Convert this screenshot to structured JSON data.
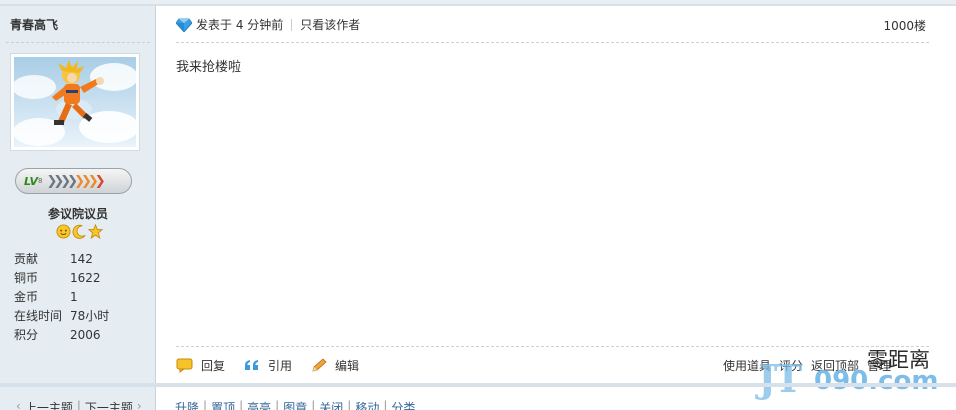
{
  "user": {
    "name": "青春高飞",
    "level_text": "LV",
    "level_sup": "8",
    "rank": "参议院议员",
    "stats": [
      {
        "label": "贡献",
        "value": "142"
      },
      {
        "label": "铜币",
        "value": "1622"
      },
      {
        "label": "金币",
        "value": "1"
      },
      {
        "label": "在线时间",
        "value": "78小时"
      },
      {
        "label": "积分",
        "value": "2006"
      }
    ]
  },
  "post": {
    "meta_posted": "发表于 4 分钟前",
    "meta_only_author": "只看该作者",
    "floor": "1000楼",
    "content": "我来抢楼啦"
  },
  "actions": {
    "reply": "回复",
    "quote": "引用",
    "edit": "编辑",
    "use_item": "使用道具",
    "rate": "评分",
    "back_top": "返回顶部",
    "manage": "管理"
  },
  "watermark": {
    "brand": "JT",
    "number": "090.com",
    "cn": "零距离"
  },
  "thread_nav": {
    "prev": "上一主题",
    "next": "下一主题"
  },
  "mod_links": [
    "升降",
    "置顶",
    "高亮",
    "图章",
    "关闭",
    "移动",
    "分类"
  ],
  "colors": {
    "sidebar_bg": "#e5edf2",
    "accent_link": "#336699",
    "level_green": "#2d8a1a"
  }
}
